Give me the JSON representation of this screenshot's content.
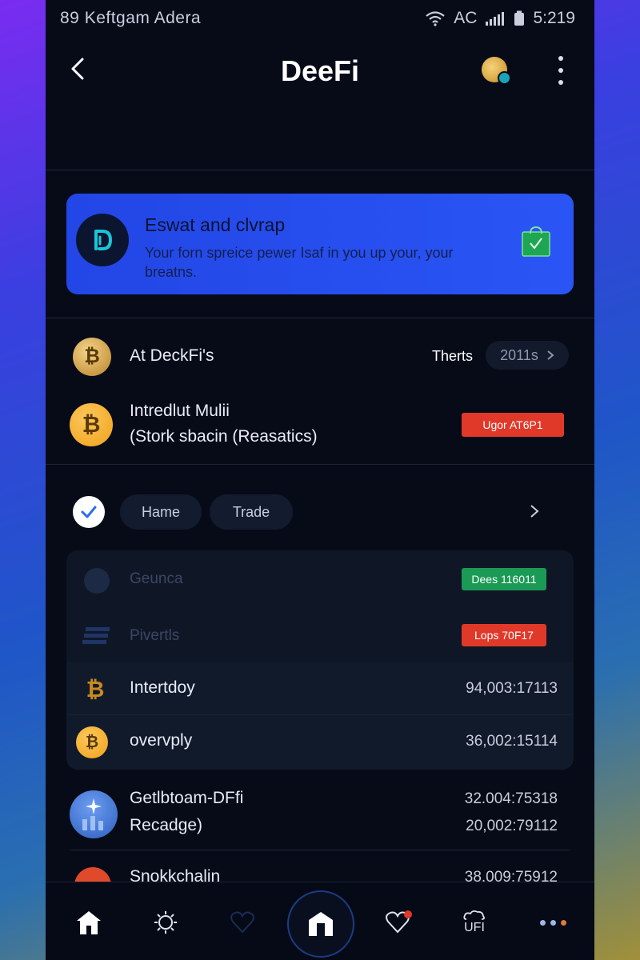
{
  "status_bar": {
    "left_text": "89 Keftgam Adera",
    "carrier": "AC",
    "time": "5:219"
  },
  "header": {
    "title": "DeeFi"
  },
  "banner": {
    "title": "Eswat and clvrap",
    "description": "Your forn spreice pewer Isaf in you up your, your breatns."
  },
  "section_top": {
    "item1": {
      "label": "At DeckFi's",
      "right_label": "Therts",
      "pill_label": "2011s"
    },
    "item2": {
      "line1": "Intredlut Mulii",
      "line2": "(Stork sbacin (Reasatics)",
      "badge": "Ugor AT6P1"
    }
  },
  "filters": {
    "chips": [
      "Hame",
      "Trade"
    ]
  },
  "card": {
    "faded": [
      {
        "name": "Geunca",
        "badge": "Dees 116011"
      },
      {
        "name": "Pivertls",
        "badge": "Lops 70F17"
      }
    ],
    "items": [
      {
        "name": "Intertdoy",
        "value": "94,003:17113"
      },
      {
        "name": "overvply",
        "value": "36,002:15114"
      }
    ]
  },
  "list": {
    "item1": {
      "line1": "Getlbtoam-DFfi",
      "line2": "Recadge)",
      "value1": "32.004:75318",
      "value2": "20,002:79112"
    },
    "item2": {
      "name": "Snokkchalin",
      "value": "38.009:75912"
    }
  },
  "tabbar": {
    "label_ufi": "UFI"
  },
  "colors": {
    "accent": "#2a55f5",
    "badge_red": "#e0392a",
    "badge_green": "#1b9a55",
    "background": "#070b18"
  }
}
